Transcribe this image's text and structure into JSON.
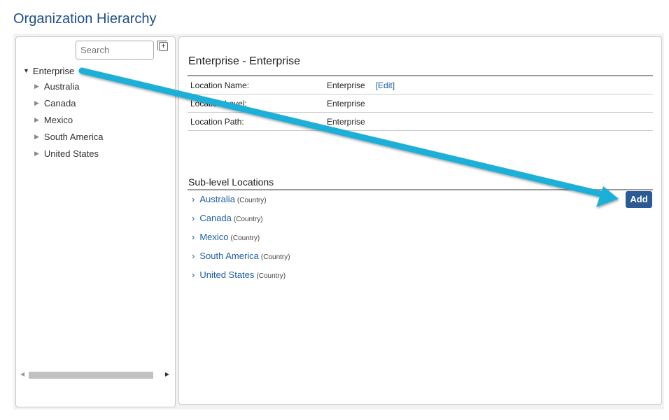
{
  "page": {
    "title": "Organization Hierarchy"
  },
  "tree": {
    "search_placeholder": "Search",
    "root": "Enterprise",
    "children": [
      "Australia",
      "Canada",
      "Mexico",
      "South America",
      "United States"
    ]
  },
  "detail": {
    "title": "Enterprise - Enterprise",
    "rows": [
      {
        "key": "Location Name:",
        "value": "Enterprise",
        "action": "[Edit]"
      },
      {
        "key": "Location Level:",
        "value": "Enterprise"
      },
      {
        "key": "Location Path:",
        "value": "Enterprise"
      }
    ],
    "sub_title": "Sub-level Locations",
    "add_label": "Add",
    "sub_items": [
      {
        "name": "Australia",
        "type": "(Country)"
      },
      {
        "name": "Canada",
        "type": "(Country)"
      },
      {
        "name": "Mexico",
        "type": "(Country)"
      },
      {
        "name": "South America",
        "type": "(Country)"
      },
      {
        "name": "United States",
        "type": "(Country)"
      }
    ]
  },
  "annotation": {
    "arrow_color": "#1fb0d9",
    "icon": "callout-arrow"
  },
  "colors": {
    "title": "#1f4e8a",
    "link": "#1f5fa6",
    "button": "#2a5b94"
  }
}
